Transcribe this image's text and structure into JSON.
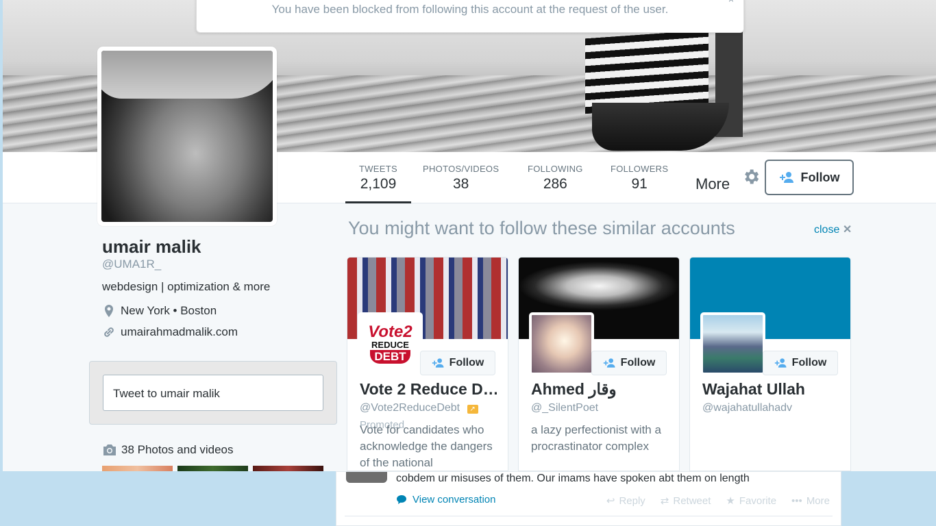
{
  "alert": {
    "message": "You have been blocked from following this account at the request of the user.",
    "close": "×"
  },
  "nav": {
    "stats": [
      {
        "label": "TWEETS",
        "value": "2,109"
      },
      {
        "label": "PHOTOS/VIDEOS",
        "value": "38"
      },
      {
        "label": "FOLLOWING",
        "value": "286"
      },
      {
        "label": "FOLLOWERS",
        "value": "91"
      }
    ],
    "more": "More",
    "follow": "Follow"
  },
  "profile": {
    "name": "umair malik",
    "handle": "@UMA1R_",
    "bio": "webdesign | optimization & more",
    "location": "New York • Boston",
    "url": "umairahmadmalik.com",
    "tweet_to": "Tweet to umair malik",
    "photos": "38 Photos and videos"
  },
  "suggestions": {
    "title": "You might want to follow these similar accounts",
    "close": "close",
    "follow_label": "Follow",
    "cards": [
      {
        "name": "Vote 2 Reduce D…",
        "handle": "@Vote2ReduceDebt",
        "promoted": "Promoted",
        "bio": "Vote for candidates who acknowledge the dangers of the national"
      },
      {
        "name": "Ahmed وقار",
        "handle": "@_SilentPoet",
        "bio": "a lazy perfectionist with a procrastinator complex"
      },
      {
        "name": "Wajahat Ullah",
        "handle": "@wajahatullahadv",
        "bio": ""
      }
    ],
    "logo_text": {
      "line1": "Vote2",
      "line2": "REDUCE",
      "line3": "DEBT"
    }
  },
  "tweet": {
    "text": "cobdem ur misuses of them. Our imams have spoken abt them on length",
    "view_conversation": "View conversation",
    "actions": {
      "reply": "Reply",
      "retweet": "Retweet",
      "favorite": "Favorite",
      "more": "More"
    }
  },
  "colors": {
    "link": "#0084b4",
    "muted": "#8899a6",
    "card_blue": "#0084b4"
  }
}
